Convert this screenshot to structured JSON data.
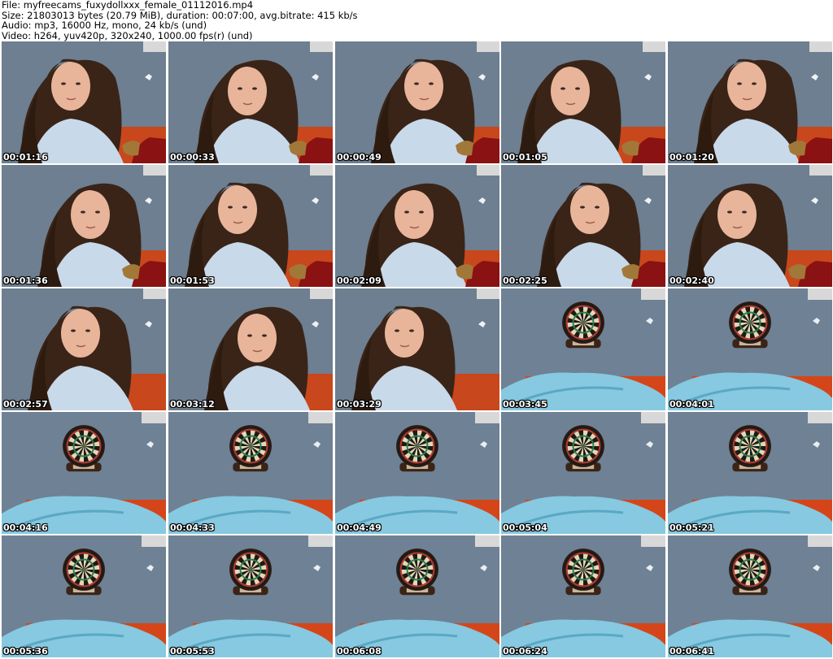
{
  "header": {
    "file_line": "File: myfreecams_fuxydollxxx_female_01112016.mp4",
    "size_line": "Size: 21803013 bytes (20.79 MiB), duration: 00:07:00, avg.bitrate: 415 kb/s",
    "audio_line": "Audio: mp3, 16000 Hz, mono, 24 kb/s (und)",
    "video_line": "Video: h264, yuv420p, 320x240, 1000.00 fps(r) (und)"
  },
  "thumbnails": [
    {
      "timestamp": "00:01:16",
      "scene": "person"
    },
    {
      "timestamp": "00:00:33",
      "scene": "person"
    },
    {
      "timestamp": "00:00:49",
      "scene": "person"
    },
    {
      "timestamp": "00:01:05",
      "scene": "person"
    },
    {
      "timestamp": "00:01:20",
      "scene": "person"
    },
    {
      "timestamp": "00:01:36",
      "scene": "person"
    },
    {
      "timestamp": "00:01:53",
      "scene": "person"
    },
    {
      "timestamp": "00:02:09",
      "scene": "person"
    },
    {
      "timestamp": "00:02:25",
      "scene": "person"
    },
    {
      "timestamp": "00:02:40",
      "scene": "person"
    },
    {
      "timestamp": "00:02:57",
      "scene": "person"
    },
    {
      "timestamp": "00:03:12",
      "scene": "person"
    },
    {
      "timestamp": "00:03:29",
      "scene": "person"
    },
    {
      "timestamp": "00:03:45",
      "scene": "dartboard"
    },
    {
      "timestamp": "00:04:01",
      "scene": "dartboard"
    },
    {
      "timestamp": "00:04:16",
      "scene": "dartboard"
    },
    {
      "timestamp": "00:04:33",
      "scene": "dartboard"
    },
    {
      "timestamp": "00:04:49",
      "scene": "dartboard"
    },
    {
      "timestamp": "00:05:04",
      "scene": "dartboard"
    },
    {
      "timestamp": "00:05:21",
      "scene": "dartboard"
    },
    {
      "timestamp": "00:05:36",
      "scene": "dartboard"
    },
    {
      "timestamp": "00:05:53",
      "scene": "dartboard"
    },
    {
      "timestamp": "00:06:08",
      "scene": "dartboard"
    },
    {
      "timestamp": "00:06:24",
      "scene": "dartboard"
    },
    {
      "timestamp": "00:06:41",
      "scene": "dartboard"
    }
  ]
}
